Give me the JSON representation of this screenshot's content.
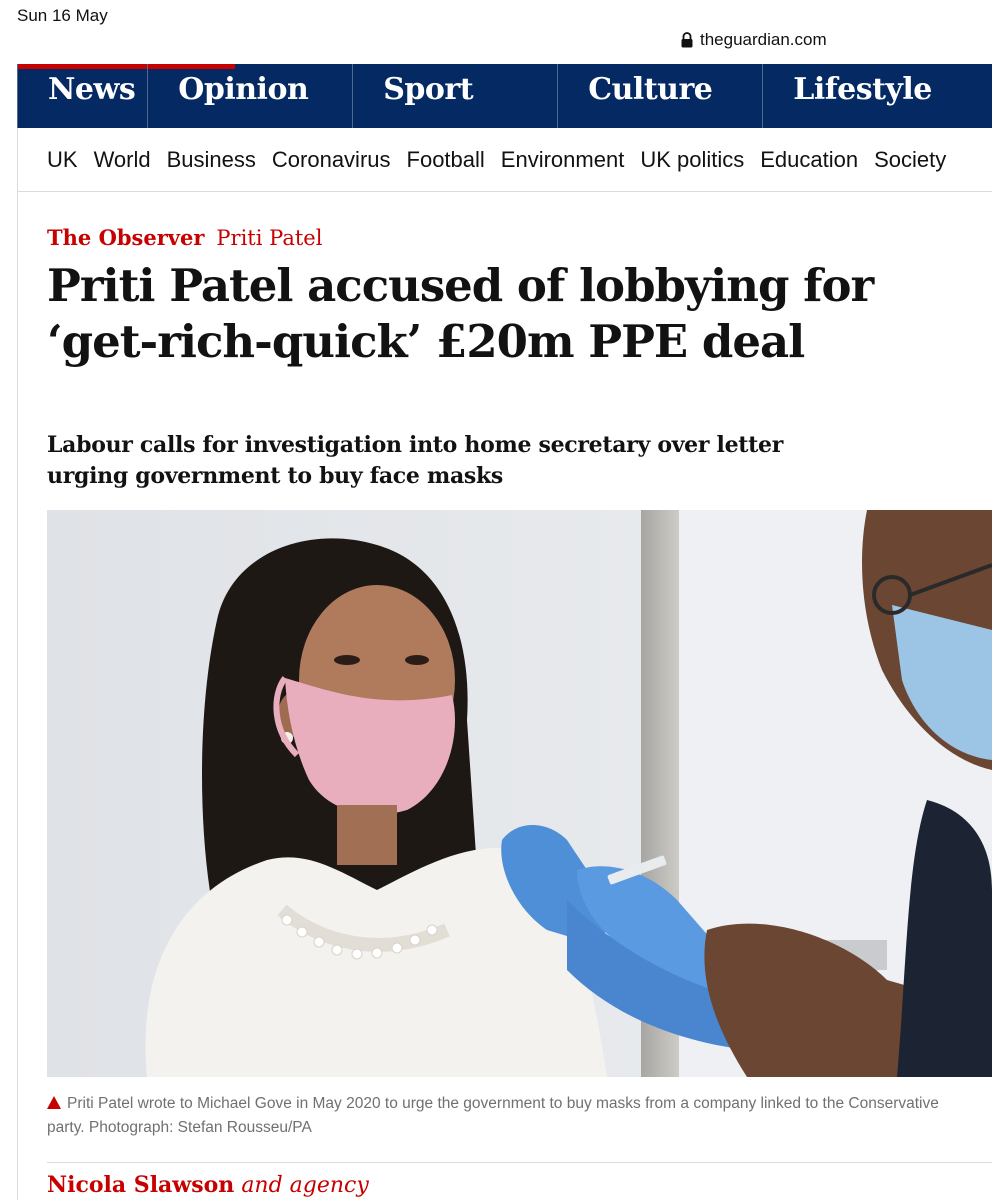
{
  "status_bar": {
    "date": "Sun 16 May",
    "url": "theguardian.com"
  },
  "pillars": [
    "News",
    "Opinion",
    "Sport",
    "Culture",
    "Lifestyle"
  ],
  "sub_nav": [
    "UK",
    "World",
    "Business",
    "Coronavirus",
    "Football",
    "Environment",
    "UK politics",
    "Education",
    "Society"
  ],
  "article": {
    "series": "The Observer",
    "tag": "Priti Patel",
    "headline": "Priti Patel accused of lobbying for ‘get-rich-quick’ £20m PPE deal",
    "standfirst": "Labour calls for investigation into home secretary over letter urging government to buy face masks",
    "caption": "Priti Patel wrote to Michael Gove in May 2020 to urge the government to buy masks from a company linked to the Conservative party. Photograph: Stefan Rousseu/PA",
    "byline_name": "Nicola Slawson",
    "byline_extra": "and agency"
  },
  "colors": {
    "nav_blue": "#052962",
    "news_red": "#c70000",
    "caption_grey": "#707070"
  },
  "icons": {
    "lock": "lock-icon",
    "caption_marker": "triangle-icon"
  }
}
